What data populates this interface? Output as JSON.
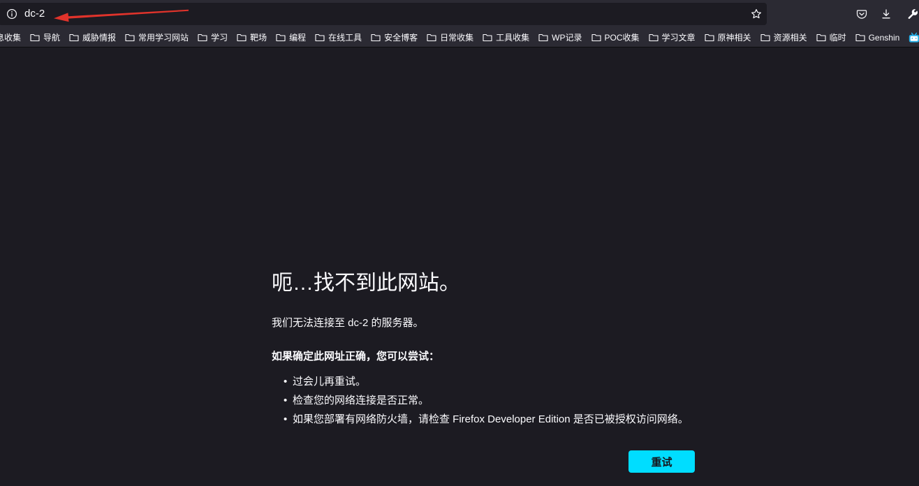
{
  "urlbar": {
    "url": "dc-2",
    "info_icon": "info-icon",
    "bookmark_icon": "star-icon"
  },
  "toolbar_icons": [
    "pocket-icon",
    "download-icon",
    "wrench-icon"
  ],
  "bookmarks": [
    {
      "label": "息收集"
    },
    {
      "label": "导航",
      "icon": "folder-icon"
    },
    {
      "label": "威胁情报",
      "icon": "folder-icon"
    },
    {
      "label": "常用学习网站",
      "icon": "folder-icon"
    },
    {
      "label": "学习",
      "icon": "folder-icon"
    },
    {
      "label": "靶场",
      "icon": "folder-icon"
    },
    {
      "label": "编程",
      "icon": "folder-icon"
    },
    {
      "label": "在线工具",
      "icon": "folder-icon"
    },
    {
      "label": "安全博客",
      "icon": "folder-icon"
    },
    {
      "label": "日常收集",
      "icon": "folder-icon"
    },
    {
      "label": "工具收集",
      "icon": "folder-icon"
    },
    {
      "label": "WP记录",
      "icon": "folder-icon"
    },
    {
      "label": "POC收集",
      "icon": "folder-icon"
    },
    {
      "label": "学习文章",
      "icon": "folder-icon"
    },
    {
      "label": "原神相关",
      "icon": "folder-icon"
    },
    {
      "label": "资源相关",
      "icon": "folder-icon"
    },
    {
      "label": "临时",
      "icon": "folder-icon"
    },
    {
      "label": "Genshin",
      "icon": "folder-icon"
    },
    {
      "icon": "bilibili-icon"
    }
  ],
  "error_page": {
    "title": "呃…找不到此网站。",
    "description": "我们无法连接至 dc-2 的服务器。",
    "suggestions_heading": "如果确定此网址正确，您可以尝试：",
    "suggestions": [
      "过会儿再重试。",
      "检查您的网络连接是否正常。",
      "如果您部署有网络防火墙，请检查 Firefox Developer Edition 是否已被授权访问网络。"
    ],
    "retry_button": "重试"
  },
  "colors": {
    "toolbar_bg": "#2b2a33",
    "urlbar_bg": "#1c1b22",
    "page_bg": "#1c1b22",
    "text": "#fbfbfe",
    "accent": "#00ddff",
    "button_text": "#15141a",
    "annotation": "#e0332b",
    "bilibili": "#23ade5"
  }
}
